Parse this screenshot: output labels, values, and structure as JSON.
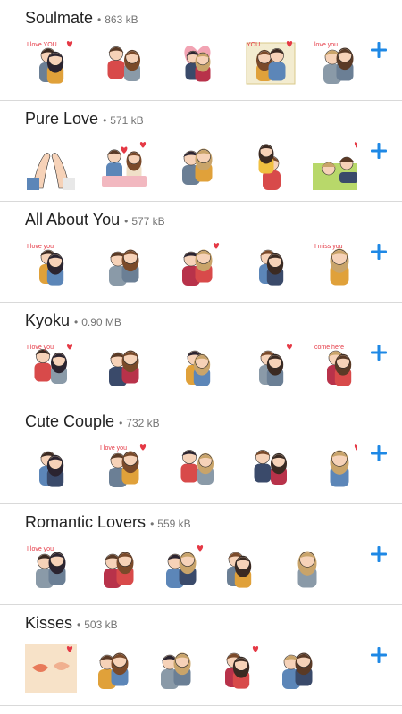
{
  "colors": {
    "accent": "#1e88e5",
    "divider": "#d9d9d9",
    "title": "#222222",
    "meta": "#757575",
    "heart": "#e53945"
  },
  "packs": [
    {
      "name": "Soulmate",
      "size": "863 kB",
      "thumb_labels": [
        "I love YOU",
        "",
        "",
        "YOU",
        "love you"
      ],
      "add_icon": "plus-icon"
    },
    {
      "name": "Pure Love",
      "size": "571 kB",
      "thumb_labels": [
        "",
        "",
        "",
        "",
        ""
      ],
      "add_icon": "plus-icon"
    },
    {
      "name": "All About You",
      "size": "577 kB",
      "thumb_labels": [
        "I love you",
        "",
        "",
        "",
        "I miss you"
      ],
      "add_icon": "plus-icon"
    },
    {
      "name": "Kyoku",
      "size": "0.90 MB",
      "thumb_labels": [
        "I love you",
        "",
        "",
        "",
        "come here"
      ],
      "add_icon": "plus-icon"
    },
    {
      "name": "Cute Couple",
      "size": "732 kB",
      "thumb_labels": [
        "",
        "I love you",
        "",
        "",
        ""
      ],
      "add_icon": "plus-icon"
    },
    {
      "name": "Romantic Lovers",
      "size": "559 kB",
      "thumb_labels": [
        "I love you",
        "",
        "",
        "",
        ""
      ],
      "add_icon": "plus-icon"
    },
    {
      "name": "Kisses",
      "size": "503 kB",
      "thumb_labels": [
        "",
        "",
        "",
        "",
        ""
      ],
      "add_icon": "plus-icon"
    }
  ]
}
